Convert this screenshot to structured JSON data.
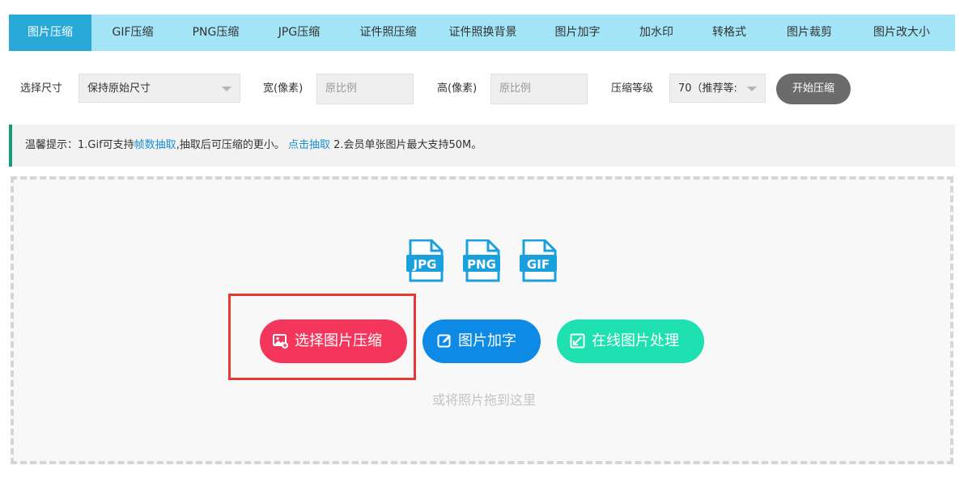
{
  "tabs": [
    {
      "label": "图片压缩",
      "active": true
    },
    {
      "label": "GIF压缩"
    },
    {
      "label": "PNG压缩"
    },
    {
      "label": "JPG压缩"
    },
    {
      "label": "证件照压缩"
    },
    {
      "label": "证件照换背景"
    },
    {
      "label": "图片加字"
    },
    {
      "label": "加水印"
    },
    {
      "label": "转格式"
    },
    {
      "label": "图片裁剪"
    },
    {
      "label": "图片改大小"
    }
  ],
  "options": {
    "size_label": "选择尺寸",
    "size_value": "保持原始尺寸",
    "width_label": "宽(像素)",
    "width_placeholder": "原比例",
    "height_label": "高(像素)",
    "height_placeholder": "原比例",
    "level_label": "压缩等级",
    "level_value": "70（推荐等:",
    "start_button": "开始压缩"
  },
  "tip": {
    "prefix": "温馨提示：1.Gif可支持",
    "link1": "帧数抽取",
    "middle": ",抽取后可压缩的更小。",
    "link2": "点击抽取",
    "suffix": " 2.会员单张图片最大支持50M。"
  },
  "formats": [
    "JPG",
    "PNG",
    "GIF"
  ],
  "buttons": {
    "select": "选择图片压缩",
    "add_text": "图片加字",
    "online": "在线图片处理"
  },
  "drag_hint": "或将照片拖到这里",
  "colors": {
    "tab_bar": "#a3e4f7",
    "tab_active": "#29a9d8",
    "select_button": "#f5365c",
    "add_text_button": "#0d8ae6",
    "online_button": "#1ee0b0",
    "format_icon": "#1aa0dc",
    "tip_border": "#169a7e",
    "highlight": "#e53935"
  }
}
